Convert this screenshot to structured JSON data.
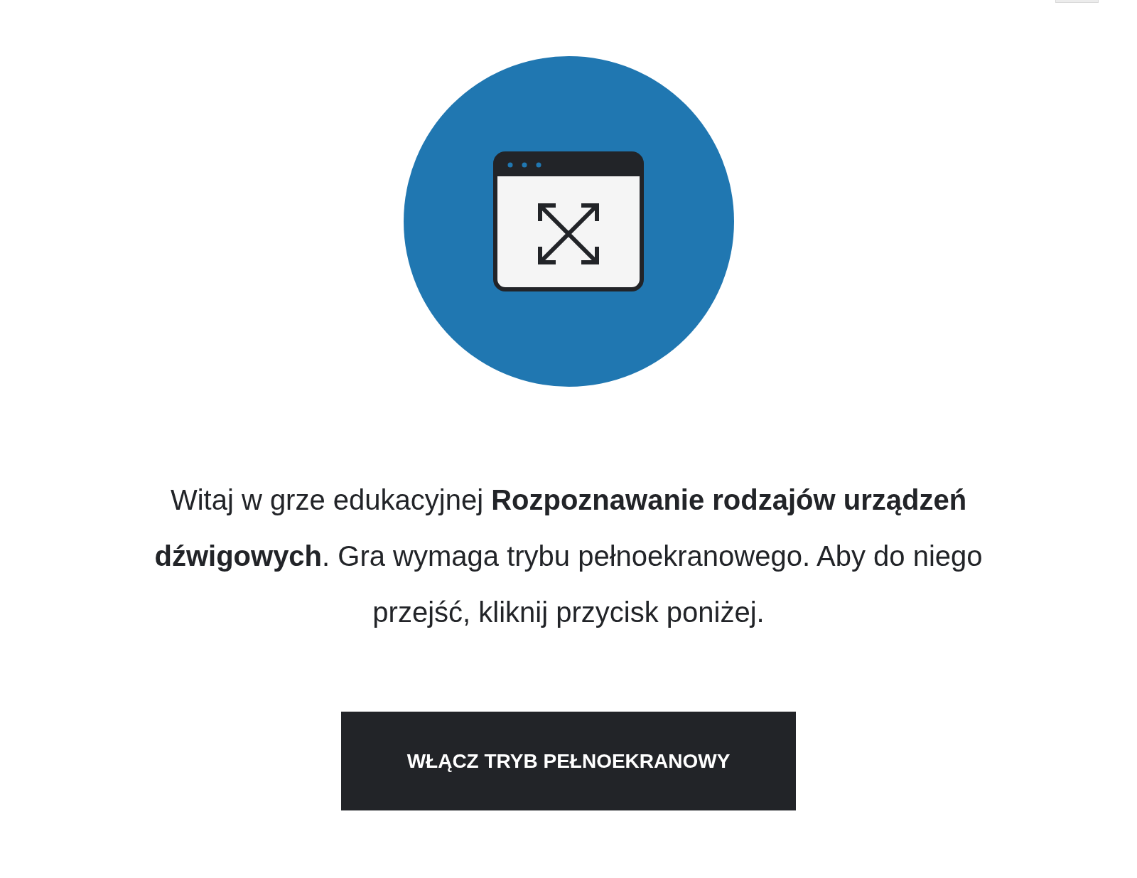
{
  "intro": {
    "text": "Witaj w grze edukacyjnej **Rozpoznawanie rodzajów urządzeń dźwigowych**. Gra wymaga trybu pełnoekranowego. Aby do niego przejść, kliknij przycisk poniżej."
  },
  "button": {
    "label": "WŁĄCZ TRYB PEŁNOEKRANOWY"
  }
}
